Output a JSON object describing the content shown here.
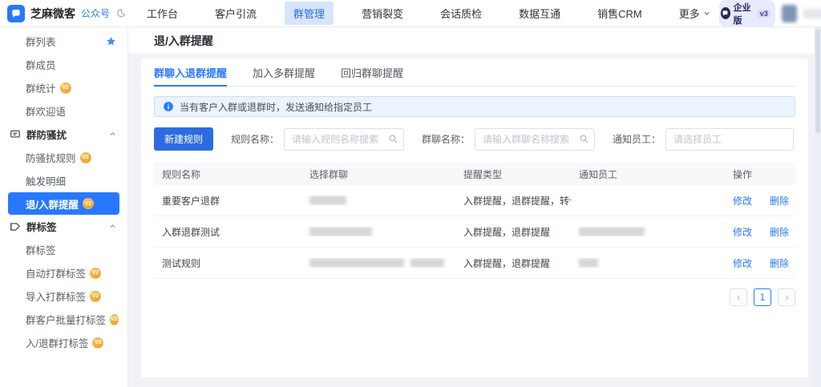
{
  "app": {
    "brand": "芝麻微客",
    "brand_tag": "公众号",
    "plan": {
      "name": "企业版",
      "version": "v3"
    }
  },
  "nav": {
    "items": [
      {
        "label": "工作台",
        "active": false
      },
      {
        "label": "客户引流",
        "active": false
      },
      {
        "label": "群管理",
        "active": true
      },
      {
        "label": "营销裂变",
        "active": false
      },
      {
        "label": "会话质检",
        "active": false
      },
      {
        "label": "数据互通",
        "active": false
      },
      {
        "label": "销售CRM",
        "active": false
      },
      {
        "label": "更多",
        "active": false,
        "dropdown": true
      }
    ]
  },
  "sidebar": {
    "badge_text": "V2",
    "items": [
      {
        "label": "群列表",
        "starred": true
      },
      {
        "label": "群成员"
      },
      {
        "label": "群统计",
        "badge": "V2"
      },
      {
        "label": "群欢迎语"
      },
      {
        "label": "群防骚扰",
        "type": "section",
        "collapsed": false
      },
      {
        "label": "防骚扰规则",
        "badge": "V2"
      },
      {
        "label": "触发明细"
      },
      {
        "label": "退/入群提醒",
        "badge": "V2",
        "selected": true
      },
      {
        "label": "群标签",
        "type": "section",
        "collapsed": false
      },
      {
        "label": "群标签"
      },
      {
        "label": "自动打群标签",
        "badge": "V2"
      },
      {
        "label": "导入打群标签",
        "badge": "V2"
      },
      {
        "label": "群客户批量打标签",
        "badge": "V2"
      },
      {
        "label": "入/退群打标签",
        "badge": "V2"
      }
    ]
  },
  "page": {
    "title": "退/入群提醒"
  },
  "tabs": {
    "items": [
      {
        "label": "群聊入退群提醒",
        "active": true
      },
      {
        "label": "加入多群提醒",
        "active": false
      },
      {
        "label": "回归群聊提醒",
        "active": false
      }
    ]
  },
  "banner": {
    "text": "当有客户入群或退群时，发送通知给指定员工"
  },
  "filters": {
    "create_button": "新建规则",
    "rule_name_label": "规则名称：",
    "rule_name_value": "",
    "rule_name_placeholder": "请输入规则名称搜索",
    "group_name_label": "群聊名称：",
    "group_name_value": "",
    "group_name_placeholder": "请输入群聊名称搜索",
    "staff_label": "通知员工：",
    "staff_value": "",
    "staff_placeholder": "请选择员工"
  },
  "table": {
    "columns": [
      "规则名称",
      "选择群聊",
      "提醒类型",
      "通知员工",
      "操作"
    ],
    "edit_label": "修改",
    "delete_label": "删除",
    "rows": [
      {
        "rule_name": "重要客户退群",
        "group_chat": "(已打码)",
        "remind_type": "入群提醒，退群提醒，转化...",
        "notify_staff": ""
      },
      {
        "rule_name": "入群退群测试",
        "group_chat": "(已打码)",
        "remind_type": "入群提醒，退群提醒",
        "notify_staff": "(已打码)"
      },
      {
        "rule_name": "测试规则",
        "group_chat": "(已打码)",
        "remind_type": "入群提醒，退群提醒",
        "notify_staff": "(已打码)"
      }
    ]
  },
  "pagination": {
    "current_page": "1"
  },
  "colors": {
    "accent": "#2878ff",
    "nav_active_bg": "#d7e5fa",
    "badge_gold": "#f5a623",
    "banner_bg": "#ecf3fd",
    "button_blue": "#2d6ce0"
  }
}
